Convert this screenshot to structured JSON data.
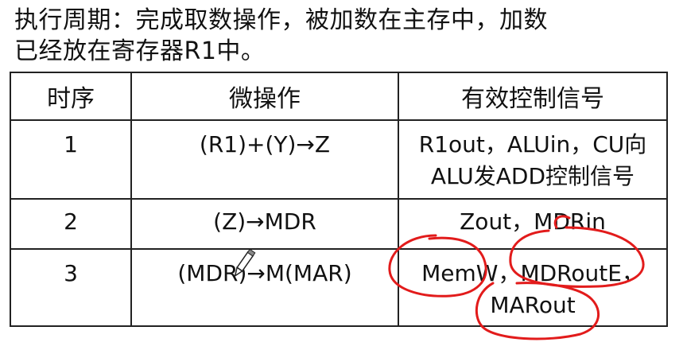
{
  "heading": {
    "line1": "执行周期：完成取数操作，被加数在主存中，加数",
    "line2": "已经放在寄存器R1中。"
  },
  "table": {
    "headers": [
      "时序",
      "微操作",
      "有效控制信号"
    ],
    "rows": [
      {
        "step": "1",
        "micro_op": "(R1)+(Y)→Z",
        "signals": [
          "R1out，ALUin，CU向",
          "ALU发ADD控制信号"
        ]
      },
      {
        "step": "2",
        "micro_op": "(Z)→MDR",
        "signals": [
          "Zout，MDRin"
        ]
      },
      {
        "step": "3",
        "micro_op": "(MDR)→M(MAR)",
        "signals": [
          "MemW，MDRoutE，",
          "MARout"
        ]
      }
    ]
  },
  "annotation": {
    "color": "#e21b1b",
    "cursor_icon": "pen-cursor-icon"
  }
}
